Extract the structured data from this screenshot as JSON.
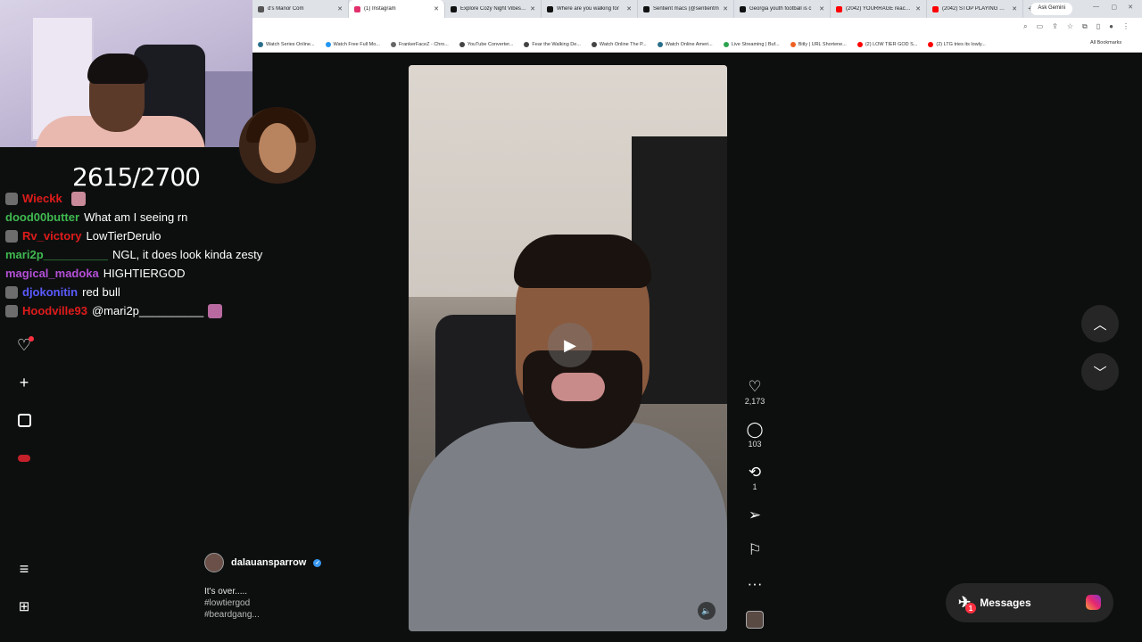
{
  "browser": {
    "tabs": [
      {
        "title": "d's Manor Com",
        "color": "#555555"
      },
      {
        "title": "(1) Instagram",
        "color": "#e1306c",
        "active": true
      },
      {
        "title": "Explore Cozy Night Vibes fo",
        "color": "#111111"
      },
      {
        "title": "Where are you walking for",
        "color": "#111111"
      },
      {
        "title": "Sentient macs (@sentientm",
        "color": "#111111"
      },
      {
        "title": "Georgia youth football is c",
        "color": "#111111"
      },
      {
        "title": "(2042) YOURRAGE reacts to",
        "color": "#ff0000"
      },
      {
        "title": "(2042) STOP PLAYING WITH",
        "color": "#ff0000"
      }
    ],
    "new_tab": "+",
    "ask_gemini": "Ask Gemini",
    "bookmarks": [
      {
        "label": "Watch Series Online...",
        "color": "#2a6e8a"
      },
      {
        "label": "Watch Free Full Mo...",
        "color": "#2196f3"
      },
      {
        "label": "FrankerFaceZ - Chro...",
        "color": "#666666"
      },
      {
        "label": "YouTube Converter...",
        "color": "#444444"
      },
      {
        "label": "Fear the Walking De...",
        "color": "#444444"
      },
      {
        "label": "Watch Online The P...",
        "color": "#444444"
      },
      {
        "label": "Watch Online Ameri...",
        "color": "#2a6e8a"
      },
      {
        "label": "Live Streaming | Buf...",
        "color": "#2ea44f"
      },
      {
        "label": "Bitly | URL Shortene...",
        "color": "#ee6123"
      },
      {
        "label": "(2) LOW TIER GOD S...",
        "color": "#ff0000"
      },
      {
        "label": "(2) LTG tries its lowly...",
        "color": "#ff0000"
      }
    ],
    "all_bookmarks": "All Bookmarks"
  },
  "stream": {
    "counter": "2615/2700"
  },
  "chat": [
    {
      "user": "Wieckk",
      "color": "#e01b1b",
      "text": "",
      "badge": true,
      "emote": "#c98a9a"
    },
    {
      "user": "dood00butter",
      "color": "#3fb950",
      "text": "What am I seeing rn",
      "badge": false
    },
    {
      "user": "Rv_victory",
      "color": "#e01b1b",
      "text": "LowTierDerulo",
      "badge": true
    },
    {
      "user": "mari2p__________",
      "color": "#3fb950",
      "text": "NGL, it does look kinda zesty",
      "badge": false
    },
    {
      "user": "magical_madoka",
      "color": "#b34fd6",
      "text": "HIGHTIERGOD",
      "badge": false
    },
    {
      "user": "djokonitin",
      "color": "#5a5aff",
      "text": "red bull",
      "badge": true
    },
    {
      "user": "Hoodville93",
      "color": "#e01b1b",
      "text": "@mari2p__________",
      "badge": true,
      "emote": "#b86aa0"
    }
  ],
  "post": {
    "author": "dalauansparrow",
    "caption": "It's over.....",
    "hashtags": [
      "#lowtiergod",
      "#beardgang..."
    ],
    "likes": "2,173",
    "comments": "103",
    "reposts": "1",
    "play_icon": "▶",
    "mute_icon": "🔈"
  },
  "sidebar": {
    "icons": [
      "notifications-heart-icon",
      "create-plus-icon",
      "dashboard-icon",
      "profile-avatar-icon",
      "menu-icon",
      "more-grid-icon"
    ]
  },
  "messages": {
    "label": "Messages",
    "badge": "1"
  },
  "colors": {
    "instagram_bg": "#0d0f0f",
    "nav_button": "#262626",
    "notification_red": "#ff3040"
  }
}
